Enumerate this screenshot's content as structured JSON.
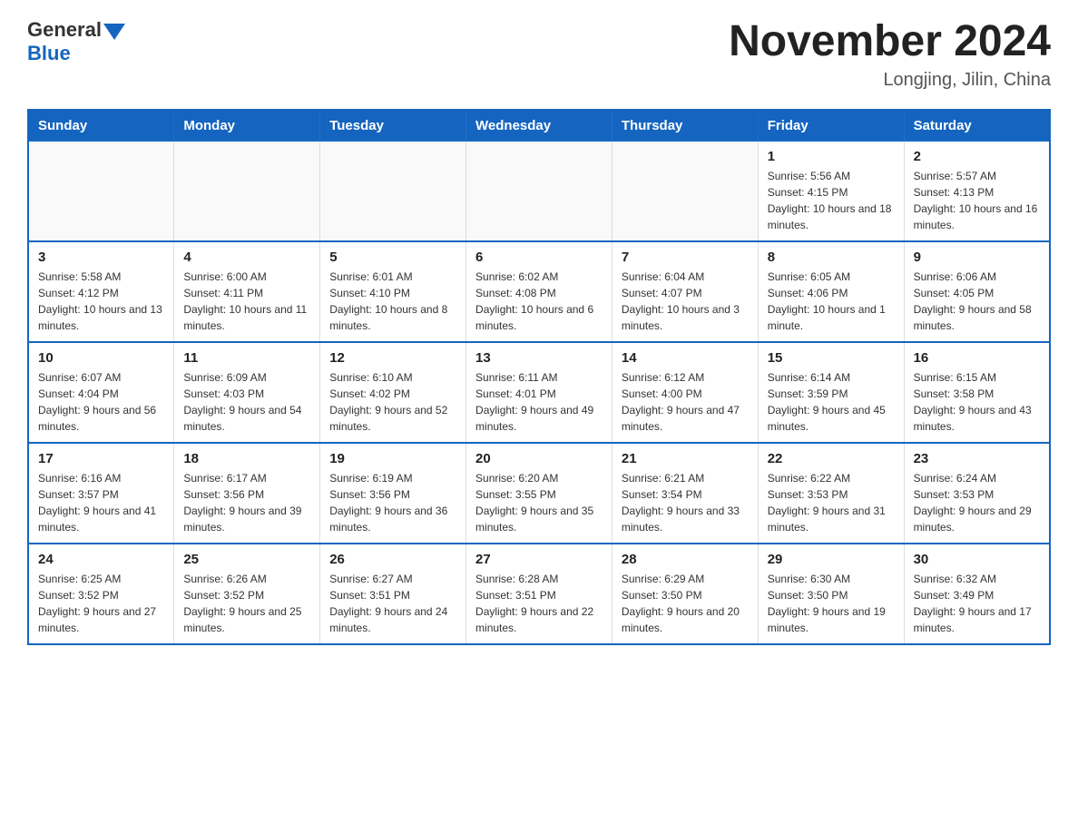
{
  "header": {
    "logo_general": "General",
    "logo_blue": "Blue",
    "month_title": "November 2024",
    "location": "Longjing, Jilin, China"
  },
  "weekdays": [
    "Sunday",
    "Monday",
    "Tuesday",
    "Wednesday",
    "Thursday",
    "Friday",
    "Saturday"
  ],
  "weeks": [
    [
      {
        "day": "",
        "sunrise": "",
        "sunset": "",
        "daylight": "",
        "empty": true
      },
      {
        "day": "",
        "sunrise": "",
        "sunset": "",
        "daylight": "",
        "empty": true
      },
      {
        "day": "",
        "sunrise": "",
        "sunset": "",
        "daylight": "",
        "empty": true
      },
      {
        "day": "",
        "sunrise": "",
        "sunset": "",
        "daylight": "",
        "empty": true
      },
      {
        "day": "",
        "sunrise": "",
        "sunset": "",
        "daylight": "",
        "empty": true
      },
      {
        "day": "1",
        "sunrise": "Sunrise: 5:56 AM",
        "sunset": "Sunset: 4:15 PM",
        "daylight": "Daylight: 10 hours and 18 minutes.",
        "empty": false
      },
      {
        "day": "2",
        "sunrise": "Sunrise: 5:57 AM",
        "sunset": "Sunset: 4:13 PM",
        "daylight": "Daylight: 10 hours and 16 minutes.",
        "empty": false
      }
    ],
    [
      {
        "day": "3",
        "sunrise": "Sunrise: 5:58 AM",
        "sunset": "Sunset: 4:12 PM",
        "daylight": "Daylight: 10 hours and 13 minutes.",
        "empty": false
      },
      {
        "day": "4",
        "sunrise": "Sunrise: 6:00 AM",
        "sunset": "Sunset: 4:11 PM",
        "daylight": "Daylight: 10 hours and 11 minutes.",
        "empty": false
      },
      {
        "day": "5",
        "sunrise": "Sunrise: 6:01 AM",
        "sunset": "Sunset: 4:10 PM",
        "daylight": "Daylight: 10 hours and 8 minutes.",
        "empty": false
      },
      {
        "day": "6",
        "sunrise": "Sunrise: 6:02 AM",
        "sunset": "Sunset: 4:08 PM",
        "daylight": "Daylight: 10 hours and 6 minutes.",
        "empty": false
      },
      {
        "day": "7",
        "sunrise": "Sunrise: 6:04 AM",
        "sunset": "Sunset: 4:07 PM",
        "daylight": "Daylight: 10 hours and 3 minutes.",
        "empty": false
      },
      {
        "day": "8",
        "sunrise": "Sunrise: 6:05 AM",
        "sunset": "Sunset: 4:06 PM",
        "daylight": "Daylight: 10 hours and 1 minute.",
        "empty": false
      },
      {
        "day": "9",
        "sunrise": "Sunrise: 6:06 AM",
        "sunset": "Sunset: 4:05 PM",
        "daylight": "Daylight: 9 hours and 58 minutes.",
        "empty": false
      }
    ],
    [
      {
        "day": "10",
        "sunrise": "Sunrise: 6:07 AM",
        "sunset": "Sunset: 4:04 PM",
        "daylight": "Daylight: 9 hours and 56 minutes.",
        "empty": false
      },
      {
        "day": "11",
        "sunrise": "Sunrise: 6:09 AM",
        "sunset": "Sunset: 4:03 PM",
        "daylight": "Daylight: 9 hours and 54 minutes.",
        "empty": false
      },
      {
        "day": "12",
        "sunrise": "Sunrise: 6:10 AM",
        "sunset": "Sunset: 4:02 PM",
        "daylight": "Daylight: 9 hours and 52 minutes.",
        "empty": false
      },
      {
        "day": "13",
        "sunrise": "Sunrise: 6:11 AM",
        "sunset": "Sunset: 4:01 PM",
        "daylight": "Daylight: 9 hours and 49 minutes.",
        "empty": false
      },
      {
        "day": "14",
        "sunrise": "Sunrise: 6:12 AM",
        "sunset": "Sunset: 4:00 PM",
        "daylight": "Daylight: 9 hours and 47 minutes.",
        "empty": false
      },
      {
        "day": "15",
        "sunrise": "Sunrise: 6:14 AM",
        "sunset": "Sunset: 3:59 PM",
        "daylight": "Daylight: 9 hours and 45 minutes.",
        "empty": false
      },
      {
        "day": "16",
        "sunrise": "Sunrise: 6:15 AM",
        "sunset": "Sunset: 3:58 PM",
        "daylight": "Daylight: 9 hours and 43 minutes.",
        "empty": false
      }
    ],
    [
      {
        "day": "17",
        "sunrise": "Sunrise: 6:16 AM",
        "sunset": "Sunset: 3:57 PM",
        "daylight": "Daylight: 9 hours and 41 minutes.",
        "empty": false
      },
      {
        "day": "18",
        "sunrise": "Sunrise: 6:17 AM",
        "sunset": "Sunset: 3:56 PM",
        "daylight": "Daylight: 9 hours and 39 minutes.",
        "empty": false
      },
      {
        "day": "19",
        "sunrise": "Sunrise: 6:19 AM",
        "sunset": "Sunset: 3:56 PM",
        "daylight": "Daylight: 9 hours and 36 minutes.",
        "empty": false
      },
      {
        "day": "20",
        "sunrise": "Sunrise: 6:20 AM",
        "sunset": "Sunset: 3:55 PM",
        "daylight": "Daylight: 9 hours and 35 minutes.",
        "empty": false
      },
      {
        "day": "21",
        "sunrise": "Sunrise: 6:21 AM",
        "sunset": "Sunset: 3:54 PM",
        "daylight": "Daylight: 9 hours and 33 minutes.",
        "empty": false
      },
      {
        "day": "22",
        "sunrise": "Sunrise: 6:22 AM",
        "sunset": "Sunset: 3:53 PM",
        "daylight": "Daylight: 9 hours and 31 minutes.",
        "empty": false
      },
      {
        "day": "23",
        "sunrise": "Sunrise: 6:24 AM",
        "sunset": "Sunset: 3:53 PM",
        "daylight": "Daylight: 9 hours and 29 minutes.",
        "empty": false
      }
    ],
    [
      {
        "day": "24",
        "sunrise": "Sunrise: 6:25 AM",
        "sunset": "Sunset: 3:52 PM",
        "daylight": "Daylight: 9 hours and 27 minutes.",
        "empty": false
      },
      {
        "day": "25",
        "sunrise": "Sunrise: 6:26 AM",
        "sunset": "Sunset: 3:52 PM",
        "daylight": "Daylight: 9 hours and 25 minutes.",
        "empty": false
      },
      {
        "day": "26",
        "sunrise": "Sunrise: 6:27 AM",
        "sunset": "Sunset: 3:51 PM",
        "daylight": "Daylight: 9 hours and 24 minutes.",
        "empty": false
      },
      {
        "day": "27",
        "sunrise": "Sunrise: 6:28 AM",
        "sunset": "Sunset: 3:51 PM",
        "daylight": "Daylight: 9 hours and 22 minutes.",
        "empty": false
      },
      {
        "day": "28",
        "sunrise": "Sunrise: 6:29 AM",
        "sunset": "Sunset: 3:50 PM",
        "daylight": "Daylight: 9 hours and 20 minutes.",
        "empty": false
      },
      {
        "day": "29",
        "sunrise": "Sunrise: 6:30 AM",
        "sunset": "Sunset: 3:50 PM",
        "daylight": "Daylight: 9 hours and 19 minutes.",
        "empty": false
      },
      {
        "day": "30",
        "sunrise": "Sunrise: 6:32 AM",
        "sunset": "Sunset: 3:49 PM",
        "daylight": "Daylight: 9 hours and 17 minutes.",
        "empty": false
      }
    ]
  ]
}
